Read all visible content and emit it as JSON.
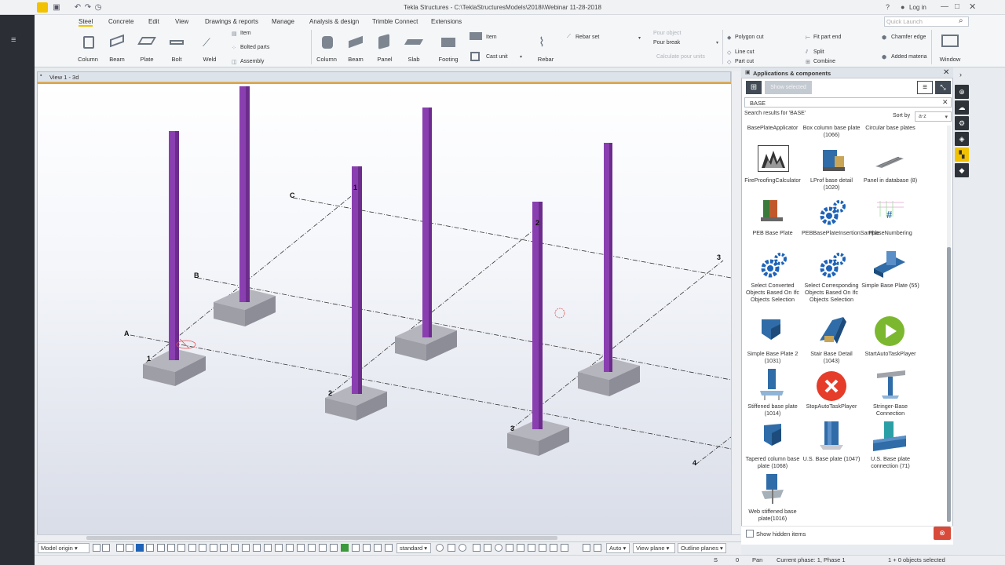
{
  "window": {
    "title": "Tekla Structures - C:\\TeklaStructuresModels\\2018i\\Webinar 11-28-2018",
    "help": "?",
    "login": "Log in",
    "quick_launch_placeholder": "Quick Launch"
  },
  "ribbon": {
    "tabs": [
      "Steel",
      "Concrete",
      "Edit",
      "View",
      "Drawings & reports",
      "Manage",
      "Analysis & design",
      "Trimble Connect",
      "Extensions"
    ],
    "steel": {
      "column": "Column",
      "beam": "Beam",
      "plate": "Plate",
      "bolt": "Bolt",
      "weld": "Weld",
      "item": "Item",
      "bolted_parts": "Bolted parts",
      "assembly": "Assembly"
    },
    "concrete": {
      "column": "Column",
      "beam": "Beam",
      "panel": "Panel",
      "slab": "Slab",
      "footing": "Footing",
      "item": "Item",
      "cast_unit": "Cast unit",
      "rebar": "Rebar",
      "rebar_set": "Rebar set",
      "pour_object": "Pour object",
      "pour_break": "Pour break",
      "calculate_pour_units": "Calculate pour units"
    },
    "edit": {
      "polygon_cut": "Polygon cut",
      "fit_part_end": "Fit part end",
      "chamfer_edge": "Chamfer edge",
      "line_cut": "Line cut",
      "split": "Split",
      "part_cut": "Part cut",
      "combine": "Combine",
      "added_material": "Added materia"
    },
    "window": "Window"
  },
  "view": {
    "title": "View 1 - 3d",
    "grid_letters": [
      "A",
      "B",
      "C"
    ],
    "grid_numbers": [
      "1",
      "2",
      "3",
      "4"
    ],
    "part_labels": [
      "1",
      "2",
      "3"
    ]
  },
  "panel": {
    "title": "Applications & components",
    "show_selected": "Show selected",
    "search_value": "BASE",
    "results_text": "Search results for 'BASE'",
    "sort_label": "Sort by",
    "sort_value": "a-z",
    "items": [
      {
        "label": "BasePlateApplicator",
        "icon": "none"
      },
      {
        "label": "Box column base plate (1066)",
        "icon": "none"
      },
      {
        "label": "Circular base plates",
        "icon": "none"
      },
      {
        "label": "FireProofingCalculator",
        "icon": "fire-icon"
      },
      {
        "label": "LProf base detail (1020)",
        "icon": "lprof-icon"
      },
      {
        "label": "Panel in database (8)",
        "icon": "panel-icon"
      },
      {
        "label": "PEB Base Plate",
        "icon": "peb-icon"
      },
      {
        "label": "PEBBasePlateInsertionSample",
        "icon": "gear-icon"
      },
      {
        "label": "PhaseNumbering",
        "icon": "phase-icon"
      },
      {
        "label": "Select Converted Objects Based On Ifc Objects Selection",
        "icon": "gear-icon"
      },
      {
        "label": "Select Corresponding Objects Based On Ifc Objects Selection",
        "icon": "gear-icon"
      },
      {
        "label": "Simple Base Plate (55)",
        "icon": "simple-plate-icon"
      },
      {
        "label": "Simple Base Plate 2 (1031)",
        "icon": "simple-plate2-icon"
      },
      {
        "label": "Stair Base Detail (1043)",
        "icon": "stair-icon"
      },
      {
        "label": "StartAutoTaskPlayer",
        "icon": "play-icon"
      },
      {
        "label": "Stiffened base plate (1014)",
        "icon": "stiffened-icon"
      },
      {
        "label": "StopAutoTaskPlayer",
        "icon": "stop-icon"
      },
      {
        "label": "Stringer-Base Connection",
        "icon": "stringer-icon"
      },
      {
        "label": "Tapered column base plate (1068)",
        "icon": "tapered-icon"
      },
      {
        "label": "U.S. Base plate (1047)",
        "icon": "us-plate-icon"
      },
      {
        "label": "U.S. Base plate connection (71)",
        "icon": "us-connection-icon"
      },
      {
        "label": "Web stiffened base plate(1016)",
        "icon": "web-stiffened-icon"
      }
    ],
    "show_hidden": "Show hidden items"
  },
  "toolbar": {
    "model_origin": "Model origin",
    "standard": "standard",
    "auto": "Auto",
    "view_plane": "View plane",
    "outline_planes": "Outline planes"
  },
  "status": {
    "s": "S",
    "zero": "0",
    "pan": "Pan",
    "phase": "Current phase: 1, Phase 1",
    "selected": "1 + 0 objects selected"
  },
  "colors": {
    "accent": "#f2c200",
    "column": "#8a3fb0",
    "footing": "#a9aab3"
  }
}
